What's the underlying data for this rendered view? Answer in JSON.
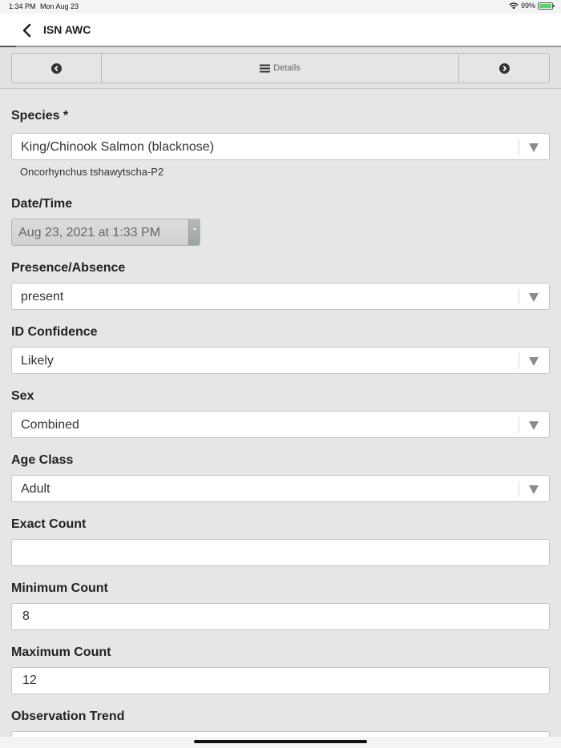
{
  "status_bar": {
    "time": "1:34 PM",
    "date": "Mon Aug 23",
    "battery": "99%",
    "battery_level": 0.99
  },
  "nav": {
    "title": "ISN AWC"
  },
  "toolbar": {
    "details_label": "Details"
  },
  "form": {
    "species": {
      "label": "Species *",
      "value": "King/Chinook Salmon (blacknose)",
      "scientific_name": "Oncorhynchus tshawytscha-P2"
    },
    "datetime": {
      "label": "Date/Time",
      "value": "Aug 23, 2021 at 1:33 PM"
    },
    "presence": {
      "label": "Presence/Absence",
      "value": "present"
    },
    "id_confidence": {
      "label": "ID Confidence",
      "value": "Likely"
    },
    "sex": {
      "label": "Sex",
      "value": "Combined"
    },
    "age_class": {
      "label": "Age Class",
      "value": "Adult"
    },
    "exact_count": {
      "label": "Exact Count",
      "value": ""
    },
    "minimum_count": {
      "label": "Minimum Count",
      "value": "8"
    },
    "maximum_count": {
      "label": "Maximum Count",
      "value": "12"
    },
    "observation_trend": {
      "label": "Observation Trend",
      "value": ""
    }
  }
}
